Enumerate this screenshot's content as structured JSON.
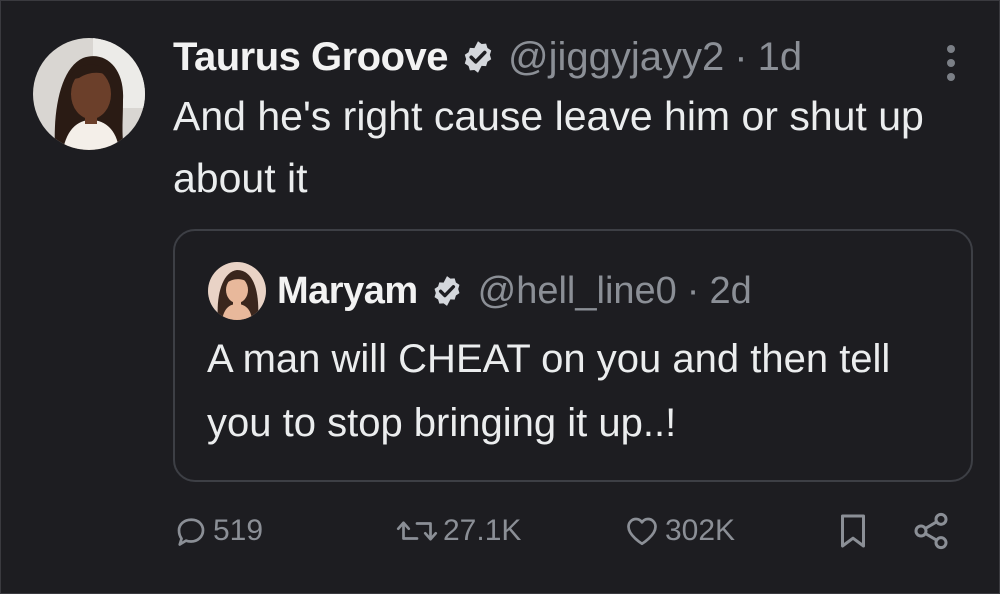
{
  "tweet": {
    "author_name": "Taurus Groove",
    "handle": "@jiggyjayy2",
    "separator": "·",
    "time": "1d",
    "text": "And he's right cause leave him or shut up about it"
  },
  "quoted_tweet": {
    "author_name": "Maryam",
    "handle": "@hell_line0",
    "separator": "·",
    "time": "2d",
    "text": "A man will CHEAT on you and then tell you to stop bringing it up..!"
  },
  "actions": {
    "replies": "519",
    "retweets": "27.1K",
    "likes": "302K"
  },
  "icons": {
    "verified": "verified-badge-icon",
    "more": "more-vertical-icon",
    "reply": "comment-bubble-icon",
    "retweet": "retweet-icon",
    "like": "heart-icon",
    "bookmark": "bookmark-icon",
    "share": "share-icon"
  },
  "colors": {
    "background": "#1d1d21",
    "text": "#ebedee",
    "muted": "#8b8f96",
    "verified_badge": "#d4d7dc",
    "border": "#3d3f45"
  }
}
